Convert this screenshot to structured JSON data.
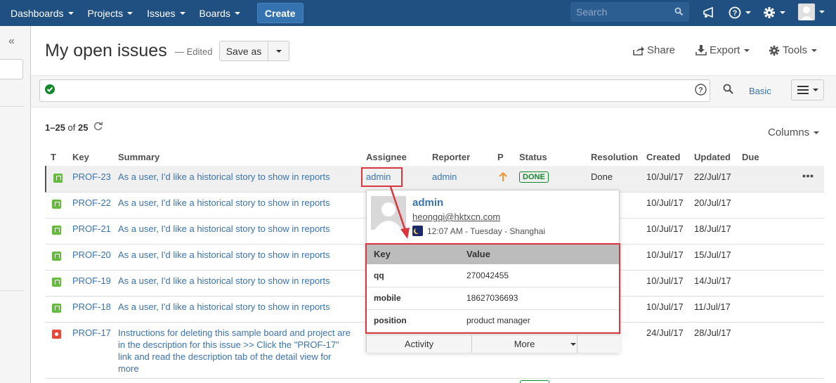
{
  "nav": {
    "items": [
      {
        "label": "Dashboards"
      },
      {
        "label": "Projects"
      },
      {
        "label": "Issues"
      },
      {
        "label": "Boards"
      }
    ],
    "create_label": "Create",
    "search_placeholder": "Search"
  },
  "header": {
    "title": "My open issues",
    "edited": "— Edited",
    "save_as": "Save as",
    "share": "Share",
    "export": "Export",
    "tools": "Tools"
  },
  "search": {
    "basic": "Basic"
  },
  "results": {
    "count_prefix": "1–",
    "count_shown": "25",
    "count_of": " of ",
    "count_total": "25",
    "columns_label": "Columns"
  },
  "table": {
    "headers": {
      "t": "T",
      "key": "Key",
      "summary": "Summary",
      "assignee": "Assignee",
      "reporter": "Reporter",
      "p": "P",
      "status": "Status",
      "resolution": "Resolution",
      "created": "Created",
      "updated": "Updated",
      "due": "Due"
    },
    "rows": [
      {
        "type": "story",
        "key": "PROF-23",
        "summary": "As a user, I'd like a historical story to show in reports",
        "assignee": "admin",
        "reporter": "admin",
        "status": "DONE",
        "resolution": "Done",
        "created": "10/Jul/17",
        "updated": "22/Jul/17"
      },
      {
        "type": "story",
        "key": "PROF-22",
        "summary": "As a user, I'd like a historical story to show in reports",
        "created": "10/Jul/17",
        "updated": "20/Jul/17"
      },
      {
        "type": "story",
        "key": "PROF-21",
        "summary": "As a user, I'd like a historical story to show in reports",
        "created": "10/Jul/17",
        "updated": "18/Jul/17"
      },
      {
        "type": "story",
        "key": "PROF-20",
        "summary": "As a user, I'd like a historical story to show in reports",
        "created": "10/Jul/17",
        "updated": "15/Jul/17"
      },
      {
        "type": "story",
        "key": "PROF-19",
        "summary": "As a user, I'd like a historical story to show in reports",
        "created": "10/Jul/17",
        "updated": "14/Jul/17"
      },
      {
        "type": "story",
        "key": "PROF-18",
        "summary": "As a user, I'd like a historical story to show in reports",
        "created": "10/Jul/17",
        "updated": "11/Jul/17"
      },
      {
        "type": "bug",
        "key": "PROF-17",
        "summary_lines": [
          "Instructions for deleting this sample board and project are",
          "in the description for this issue >> Click the \"PROF-17\"",
          "link and read the description tab of the detail view for",
          "more"
        ],
        "created": "24/Jul/17",
        "updated": "28/Jul/17"
      }
    ]
  },
  "popup": {
    "name": "admin",
    "email": "heongqi@hktxcn.com",
    "time": "12:07 AM - Tuesday - Shanghai",
    "kv_headers": {
      "key": "Key",
      "value": "Value"
    },
    "kv": [
      {
        "key": "qq",
        "value": "270042455"
      },
      {
        "key": "mobile",
        "value": "18627036693"
      },
      {
        "key": "position",
        "value": "product manager"
      }
    ],
    "activity": "Activity",
    "more": "More"
  },
  "colors": {
    "nav_bg": "#205081",
    "link": "#3b73af",
    "done": "#14892c",
    "highlight": "#d9363e",
    "priority_arrow": "#f79232"
  }
}
